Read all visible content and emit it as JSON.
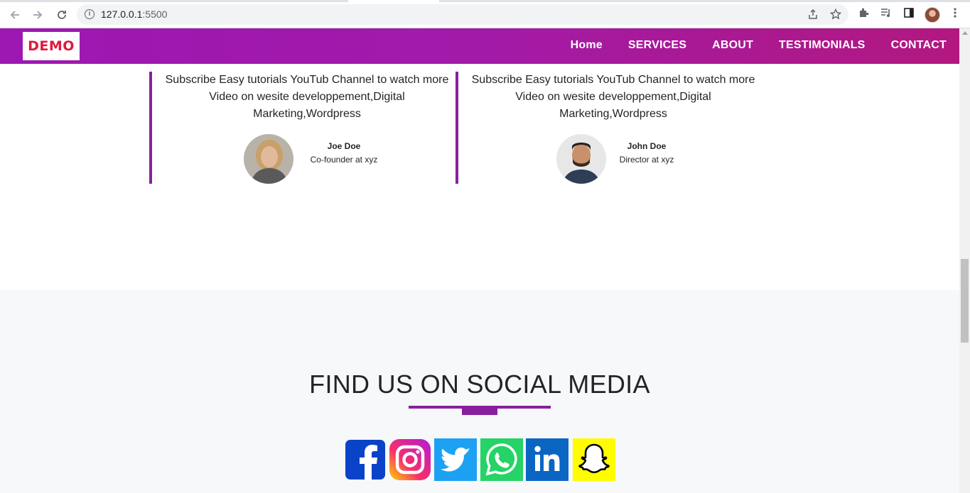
{
  "browser": {
    "url_host": "127.0.0.1",
    "url_port": ":5500"
  },
  "site": {
    "logo_text": "DEMO",
    "menu": [
      "Home",
      "SERVICES",
      "ABOUT",
      "TESTIMONIALS",
      "CONTACT"
    ]
  },
  "testimonials": [
    {
      "quote": "Subscribe Easy tutorials YouTub Channel to watch more Video on wesite developpement,Digital Marketing,Wordpress",
      "name": "Joe Doe",
      "role": "Co-founder at xyz"
    },
    {
      "quote": "Subscribe Easy tutorials YouTub Channel to watch more Video on wesite developpement,Digital Marketing,Wordpress",
      "name": "John Doe",
      "role": "Director at xyz"
    }
  ],
  "social": {
    "heading": "FIND US ON SOCIAL MEDIA",
    "accent_color": "#8a1f9e",
    "icons": [
      "facebook-icon",
      "instagram-icon",
      "twitter-icon",
      "whatsapp-icon",
      "linkedin-icon",
      "snapchat-icon"
    ]
  }
}
